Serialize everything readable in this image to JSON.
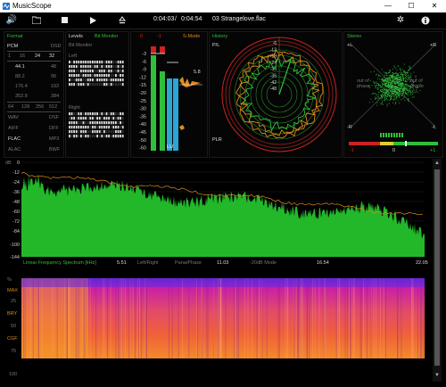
{
  "window": {
    "title": "MusicScope",
    "minimize": "—",
    "maximize": "☐",
    "close": "✕"
  },
  "toolbar": {
    "position": "0:04:03",
    "separator": "/",
    "duration": "0:04:54",
    "track": "03 Strangelove.flac"
  },
  "format": {
    "title": "Format",
    "row1": [
      "PCM",
      "DSD"
    ],
    "row2": [
      "1",
      "16",
      "24",
      "32"
    ],
    "rates": [
      [
        "44.1",
        "48"
      ],
      [
        "88.2",
        "96"
      ],
      [
        "176.4",
        "192"
      ],
      [
        "352.8",
        "384"
      ]
    ],
    "dsd_rates": [
      "64",
      "128",
      "256",
      "512"
    ],
    "codecs": [
      [
        "WAV",
        "DSF"
      ],
      [
        "AIFF",
        "DFF"
      ],
      [
        "FLAC",
        "MP3"
      ],
      [
        "ALAC",
        "BWF"
      ]
    ]
  },
  "levels": {
    "title": "Levels",
    "subtitle": "Bit Monitor",
    "subtitle2": "Bit Monitor",
    "left": "Left",
    "right": "Right"
  },
  "meter": {
    "peak_l": "0",
    "peak_r": "-1",
    "smode": "S-Mode",
    "scale": [
      "-3",
      "-6",
      "-9",
      "-12",
      "-15",
      "-20",
      "-25",
      "-30",
      "-35",
      "-40",
      "-45",
      "-50",
      "-60"
    ],
    "value": "5.8",
    "lu": "LU",
    "lr": "LR"
  },
  "history": {
    "title": "History",
    "pl": "P/L",
    "plr": "PLR",
    "scale": [
      "-6",
      "-12",
      "-18",
      "-24",
      "-30",
      "-36",
      "-42",
      "-48"
    ]
  },
  "stereo": {
    "title": "Stereo",
    "l_plus": "+L",
    "r_plus": "+R",
    "l_minus": "-L",
    "r_minus": "-R",
    "out_left": "out of\nphase",
    "out_right": "out of\nphase",
    "corr_minus": "-1",
    "corr_zero": "0",
    "corr_plus": "+1"
  },
  "spectrum": {
    "db_label": "dB",
    "yticks": [
      "0",
      "-12",
      "-24",
      "-36",
      "-48",
      "-60",
      "-72",
      "-84",
      "-100",
      "-144"
    ],
    "caption": "Linear Frequency Spectrum [kHz]",
    "xticks": [
      "5.51",
      "11.03",
      "16.54",
      "22.05"
    ],
    "modes": [
      "Left/Right",
      "Pana/Phase",
      "-20dB Mode"
    ]
  },
  "spectrogram": {
    "labels": [
      "%",
      "MAX",
      "25",
      "BRY",
      "50",
      "CGF",
      "75",
      "",
      "100"
    ]
  },
  "colors": {
    "accent_green": "#2fbf3a",
    "accent_red": "#e02020",
    "accent_orange": "#e08a1a",
    "accent_blue": "#2aa6d6"
  }
}
